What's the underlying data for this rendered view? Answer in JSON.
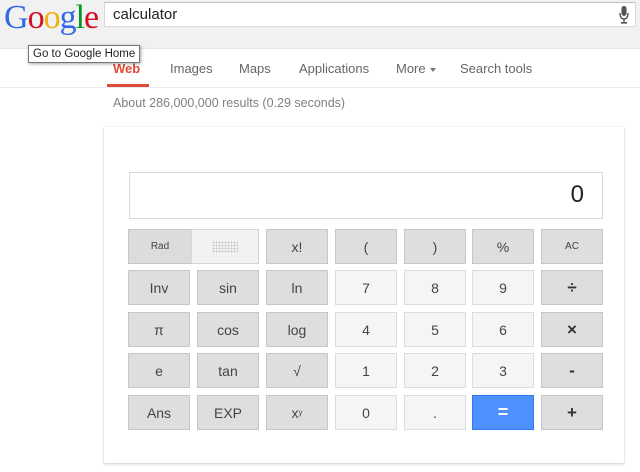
{
  "logo": {
    "letters": [
      "G",
      "o",
      "o",
      "g",
      "l",
      "e"
    ],
    "colors": [
      "#3369e8",
      "#d50f25",
      "#eeb211",
      "#3369e8",
      "#009925",
      "#d50f25"
    ]
  },
  "search": {
    "query": "calculator"
  },
  "tooltip": "Go to Google Home",
  "nav": {
    "items": [
      {
        "label": "Web",
        "active": true
      },
      {
        "label": "Images"
      },
      {
        "label": "Maps"
      },
      {
        "label": "Applications"
      },
      {
        "label": "More"
      },
      {
        "label": "Search tools"
      }
    ]
  },
  "stats": "About 286,000,000 results (0.29 seconds)",
  "calculator": {
    "display": "0",
    "mode_active": "Rad",
    "keys": {
      "rad": "Rad",
      "fact": "x!",
      "lparen": "(",
      "rparen": ")",
      "percent": "%",
      "ac": "AC",
      "inv": "Inv",
      "sin": "sin",
      "ln": "ln",
      "seven": "7",
      "eight": "8",
      "nine": "9",
      "divide": "÷",
      "pi": "π",
      "cos": "cos",
      "log": "log",
      "four": "4",
      "five": "5",
      "six": "6",
      "multiply": "×",
      "e": "e",
      "tan": "tan",
      "sqrt": "√",
      "one": "1",
      "two": "2",
      "three": "3",
      "minus": "-",
      "ans": "Ans",
      "exp": "EXP",
      "pow_base": "x",
      "pow_exp": "y",
      "zero": "0",
      "dot": ".",
      "equals": "=",
      "plus": "+"
    }
  },
  "accent_colors": {
    "active_tab": "#dd4b39",
    "equals_button": "#4d90fe"
  }
}
